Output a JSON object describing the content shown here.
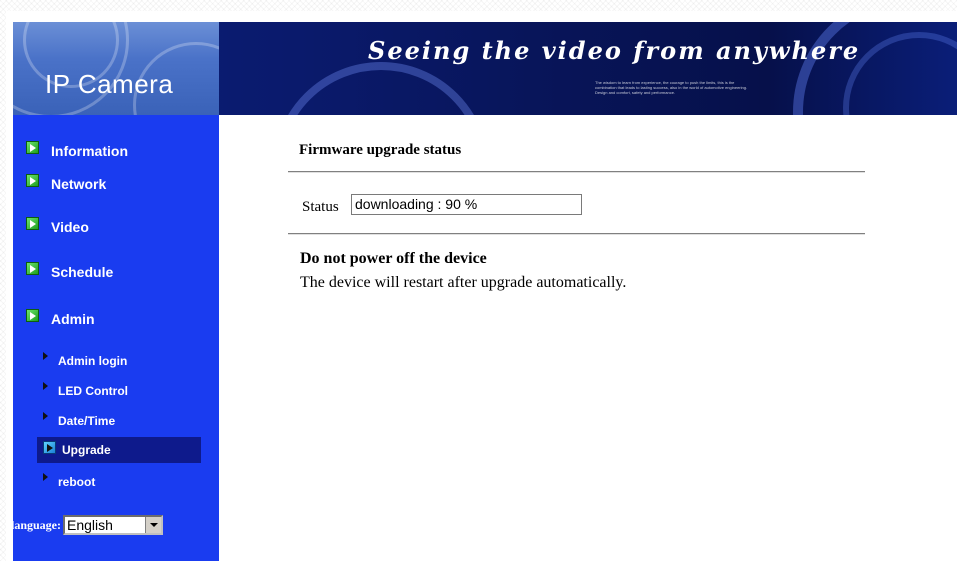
{
  "banner": {
    "title": "IP Camera",
    "slogan": "Seeing the video from anywhere",
    "fine_print": "The wisdom to learn from experience, the courage to push the limits, this is the combination that leads to lasting success, also in the world of automotive engineering. Design and comfort, safety and performance."
  },
  "sidebar": {
    "main_items": [
      {
        "label": "Information"
      },
      {
        "label": "Network"
      },
      {
        "label": "Video"
      },
      {
        "label": "Schedule"
      },
      {
        "label": "Admin"
      }
    ],
    "sub_items": [
      {
        "label": "Admin login"
      },
      {
        "label": "LED Control"
      },
      {
        "label": "Date/Time"
      },
      {
        "label": "Upgrade"
      },
      {
        "label": "reboot"
      }
    ],
    "active_sub_item": "Upgrade",
    "language": {
      "label": "language:",
      "selected": "English"
    }
  },
  "main": {
    "title": "Firmware upgrade status",
    "status_label": "Status",
    "status_value": "downloading : 90 %",
    "warning_title": "Do not power off the device",
    "warning_text": "The device will restart after upgrade automatically."
  },
  "colors": {
    "sidebar_bg": "#1a3cf0",
    "active_item_bg": "#0e1a8c",
    "banner_bg": "#08155a"
  }
}
